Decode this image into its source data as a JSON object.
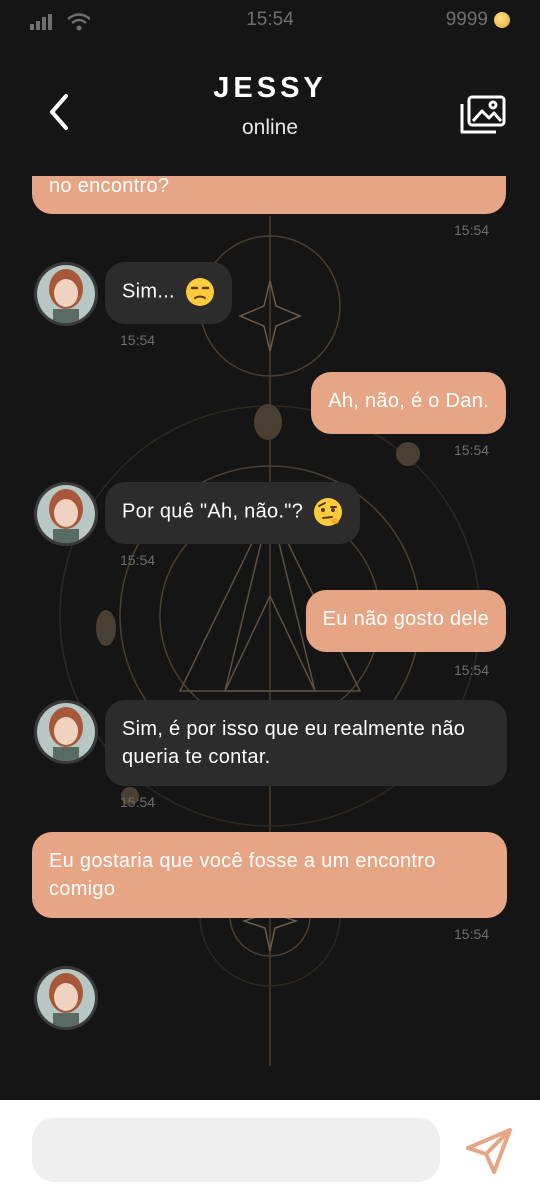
{
  "status": {
    "time": "15:54",
    "coins": "9999",
    "signal_icon": "signal-icon",
    "wifi_icon": "wifi-icon",
    "coin_icon": "coin-icon"
  },
  "header": {
    "title": "JESSY",
    "subtitle": "online",
    "back_icon": "chevron-left-icon",
    "gallery_icon": "gallery-icon"
  },
  "messages": [
    {
      "side": "out",
      "text": "no encontro?",
      "time": "15:54"
    },
    {
      "side": "in",
      "text": "Sim...",
      "emoji": "unamused-face",
      "time": "15:54"
    },
    {
      "side": "out",
      "text": "Ah, não, é o Dan.",
      "time": "15:54"
    },
    {
      "side": "in",
      "text": "Por quê \"Ah, não.\"?",
      "emoji": "raised-eyebrow-face",
      "time": "15:54"
    },
    {
      "side": "out",
      "text": "Eu não gosto dele",
      "time": "15:54"
    },
    {
      "side": "in",
      "text": "Sim, é por isso que eu realmente não queria te contar.",
      "time": "15:54"
    },
    {
      "side": "out",
      "text": "Eu gostaria que você fosse a um encontro comigo",
      "time": "15:54"
    }
  ],
  "composer": {
    "placeholder": "",
    "send_icon": "send-icon"
  },
  "colors": {
    "outgoing_bubble": "#e6a584",
    "incoming_bubble": "#2c2c2c",
    "background": "#151515",
    "send_accent": "#e6a584"
  }
}
